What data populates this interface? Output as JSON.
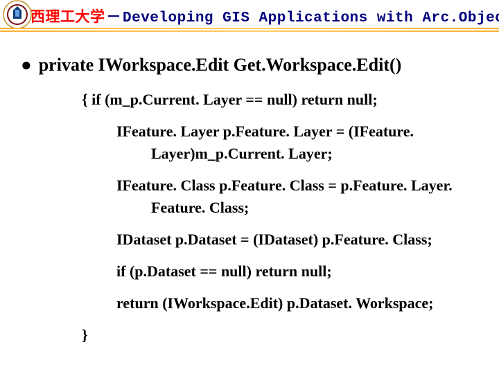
{
  "header": {
    "title_cn": "西理工大学",
    "title_dash": "－",
    "title_en": "Developing GIS Applications with Arc.Objects using C#.NE",
    "logo_name": "university-crest-icon"
  },
  "slide": {
    "bullet": "private IWorkspace.Edit Get.Workspace.Edit()",
    "code": {
      "l1": "{   if (m_p.Current. Layer == null) return null;",
      "l2": "IFeature. Layer p.Feature. Layer = (IFeature. Layer)m_p.Current. Layer;",
      "l3": "IFeature. Class p.Feature. Class = p.Feature. Layer. Feature. Class;",
      "l4": "IDataset p.Dataset = (IDataset) p.Feature. Class;",
      "l5": "if (p.Dataset == null) return null;",
      "l6": "return (IWorkspace.Edit) p.Dataset. Workspace;",
      "l7": "}"
    }
  }
}
